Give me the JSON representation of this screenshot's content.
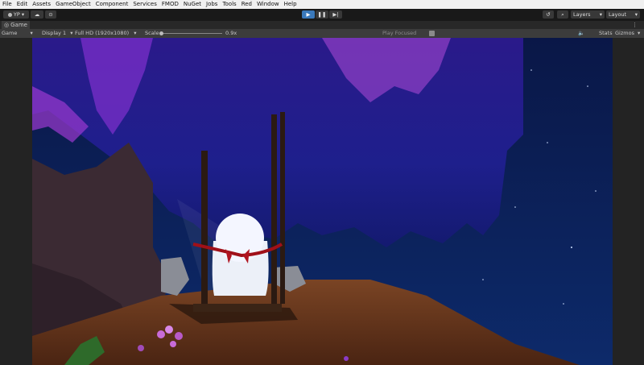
{
  "menu": [
    "File",
    "Edit",
    "Assets",
    "GameObject",
    "Component",
    "Services",
    "FMOD",
    "NuGet",
    "Jobs",
    "Tools",
    "Red",
    "Window",
    "Help"
  ],
  "toolbar": {
    "account_label": "YP",
    "layers_label": "Layers",
    "layout_label": "Layout"
  },
  "tab": {
    "label": "Game"
  },
  "game_toolbar": {
    "view_mode": "Game",
    "display": "Display 1",
    "resolution": "Full HD (1920x1080)",
    "scale_label": "Scale",
    "scale_value": "0.9x",
    "play_focused": "Play Focused",
    "stats": "Stats",
    "gizmos": "Gizmos"
  },
  "colors": {
    "accent_play": "#3a79bb",
    "sky": "#0b1a4a",
    "foliage": "#7b2fc9",
    "ground": "#6b3a1f"
  }
}
